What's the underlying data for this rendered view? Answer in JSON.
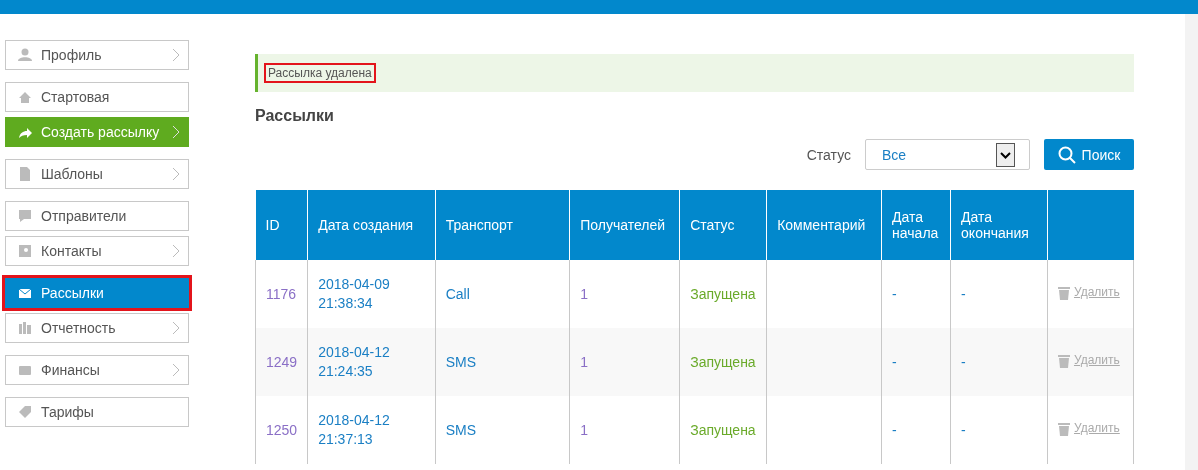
{
  "sidebar": {
    "groups": [
      {
        "items": [
          {
            "label": "Профиль",
            "arrow": true,
            "selected": false,
            "kind": "normal",
            "highlighted": false
          }
        ]
      },
      {
        "items": [
          {
            "label": "Стартовая",
            "arrow": false,
            "selected": false,
            "kind": "normal",
            "highlighted": false
          },
          {
            "label": "Создать рассылку",
            "arrow": true,
            "selected": false,
            "kind": "action",
            "highlighted": false
          }
        ]
      },
      {
        "items": [
          {
            "label": "Шаблоны",
            "arrow": true,
            "selected": false,
            "kind": "normal",
            "highlighted": false
          }
        ]
      },
      {
        "items": [
          {
            "label": "Отправители",
            "arrow": false,
            "selected": false,
            "kind": "normal",
            "highlighted": false
          },
          {
            "label": "Контакты",
            "arrow": true,
            "selected": false,
            "kind": "normal",
            "highlighted": false
          }
        ]
      },
      {
        "items": [
          {
            "label": "Рассылки",
            "arrow": false,
            "selected": true,
            "kind": "normal",
            "highlighted": true
          },
          {
            "label": "Отчетность",
            "arrow": true,
            "selected": false,
            "kind": "normal",
            "highlighted": false
          }
        ]
      },
      {
        "items": [
          {
            "label": "Финансы",
            "arrow": true,
            "selected": false,
            "kind": "normal",
            "highlighted": false
          }
        ]
      },
      {
        "items": [
          {
            "label": "Тарифы",
            "arrow": false,
            "selected": false,
            "kind": "normal",
            "highlighted": false
          }
        ]
      }
    ]
  },
  "notice": {
    "text": "Рассылка удалена",
    "highlighted": true
  },
  "heading": "Рассылки",
  "filter": {
    "label": "Статус",
    "value": "Все",
    "button": "Поиск"
  },
  "table": {
    "columns": [
      "ID",
      "Дата создания",
      "Транспорт",
      "Получателей",
      "Статус",
      "Комментарий",
      "Дата начала",
      "Дата окончания"
    ],
    "rows": [
      {
        "id": "1176",
        "created": [
          "2018-04-09",
          "21:38:34"
        ],
        "transport": "Call",
        "recipients": "1",
        "status": "Запущена",
        "start": "-",
        "end": "-",
        "action": "Удалить"
      },
      {
        "id": "1249",
        "created": [
          "2018-04-12",
          "21:24:35"
        ],
        "transport": "SMS",
        "recipients": "1",
        "status": "Запущена",
        "start": "-",
        "end": "-",
        "action": "Удалить"
      },
      {
        "id": "1250",
        "created": [
          "2018-04-12",
          "21:37:13"
        ],
        "transport": "SMS",
        "recipients": "1",
        "status": "Запущена",
        "start": "-",
        "end": "-",
        "action": "Удалить"
      }
    ]
  }
}
